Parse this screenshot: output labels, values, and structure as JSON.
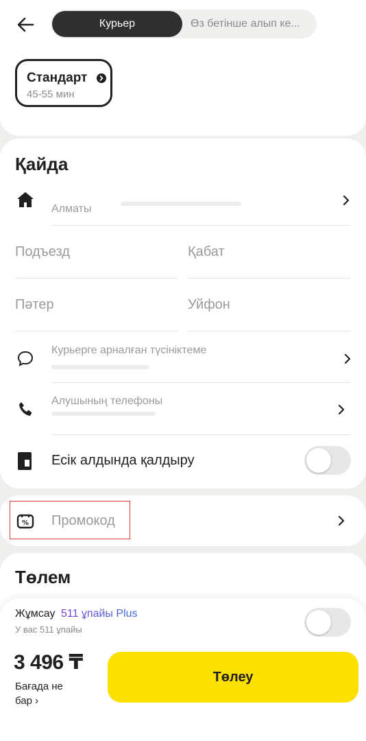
{
  "header": {
    "back_icon": "arrow-left-icon",
    "tabs": [
      {
        "label": "Курьер",
        "selected": true
      },
      {
        "label": "Өз бетінше алып ке...",
        "selected": false
      }
    ]
  },
  "tariff": {
    "title": "Стандарт",
    "time": "45-55 мин",
    "info_icon": "chevron-right-circle-icon"
  },
  "address": {
    "title": "Қайда",
    "city": "Алматы",
    "fields": {
      "entrance": "Подъезд",
      "floor": "Қабат",
      "apartment": "Пәтер",
      "intercom": "Уйфон"
    },
    "comment_label": "Курьерге арналған түсініктеме",
    "phone_label": "Алушының телефоны",
    "leave_at_door": "Есік алдында қалдыру",
    "leave_at_door_enabled": false
  },
  "promo": {
    "label": "Промокод",
    "highlight_color": "#e53935"
  },
  "payment": {
    "title": "Төлем"
  },
  "bottom": {
    "spend_label": "Жұмсау",
    "plus_points": "511 ұпайы Plus",
    "balance_note": "У вас 511 ұпайы",
    "plus_enabled": false,
    "price": "3 496 ₸",
    "price_note_1": "Бағада не",
    "price_note_2": "бар ›",
    "pay_button": "Төлеу"
  },
  "colors": {
    "accent_yellow": "#fce000",
    "plus_purple": "#7a3ed6",
    "plus_blue": "#3d6bdc",
    "segment_dark": "#2f2f2f"
  }
}
